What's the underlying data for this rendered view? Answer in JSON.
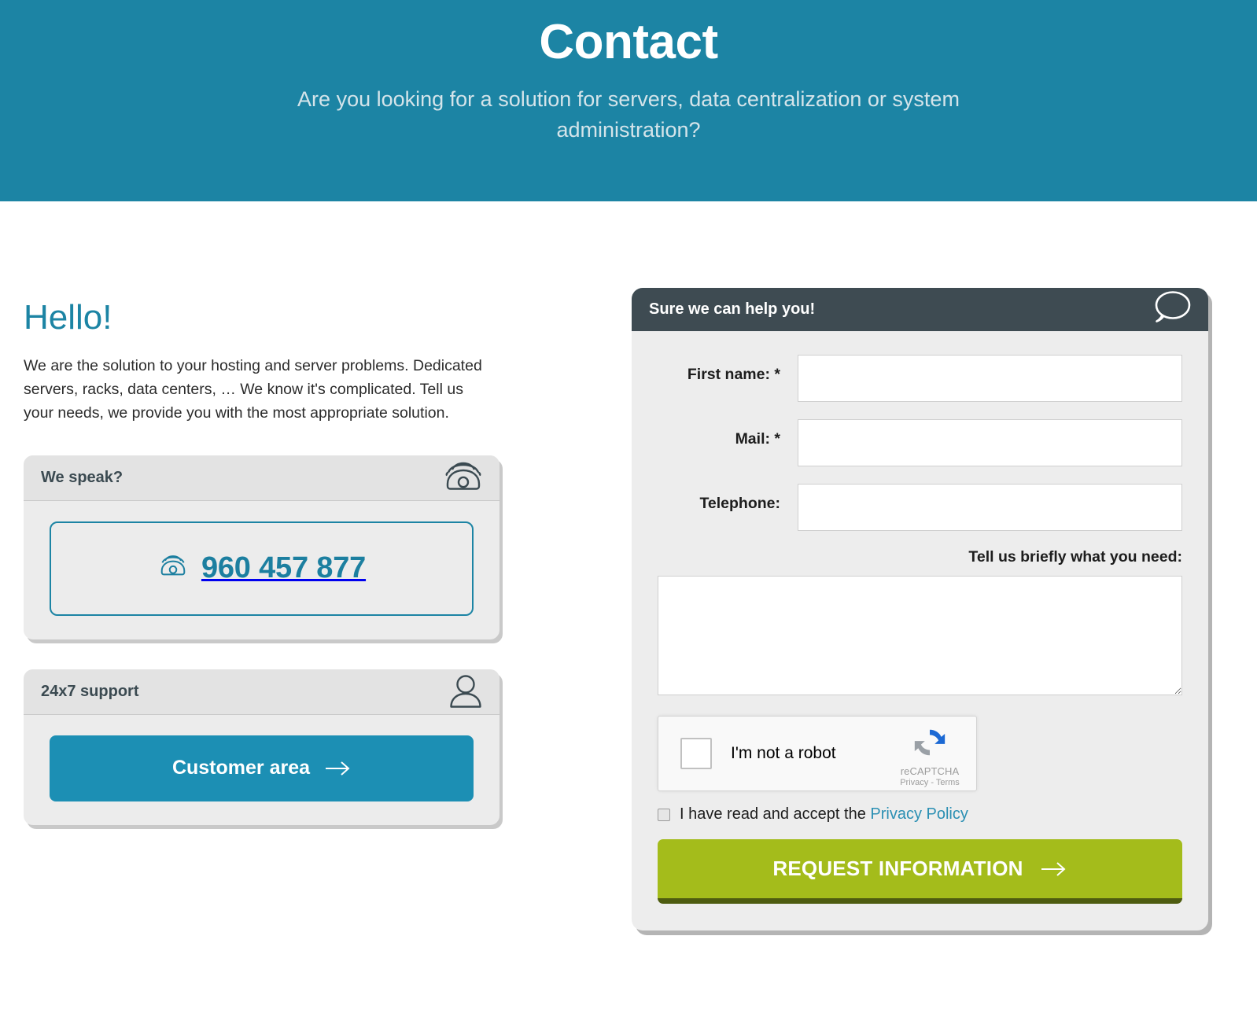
{
  "hero": {
    "title": "Contact",
    "subtitle": "Are you looking for a solution for servers, data centralization or system administration?",
    "bg_color": "#1c84a4"
  },
  "intro": {
    "heading": "Hello!",
    "body": "We are the solution to your hosting and server problems. Dedicated servers, racks, data centers, … We know it's complicated. Tell us your needs, we provide you with the most appropriate solution.",
    "heading_color": "#1c84a4"
  },
  "phone_card": {
    "header_title": "We speak?",
    "header_icon": "telephone-icon",
    "phone_number": "960 457 877",
    "phone_icon": "telephone-icon",
    "accent_color": "#1c7fa0"
  },
  "support_card": {
    "header_title": "24x7 support",
    "header_icon": "user-icon",
    "button_label": "Customer area",
    "button_icon": "arrow-right-icon",
    "button_color": "#1c8fb4"
  },
  "form": {
    "header_title": "Sure we can help you!",
    "header_icon": "speech-bubble-icon",
    "header_bg": "#3e4b52",
    "fields": [
      {
        "label": "First name: *",
        "value": "",
        "placeholder": ""
      },
      {
        "label": "Mail: *",
        "value": "",
        "placeholder": ""
      },
      {
        "label": "Telephone:",
        "value": "",
        "placeholder": ""
      }
    ],
    "message_label": "Tell us briefly what you need:",
    "message_value": "",
    "recaptcha": {
      "label": "I'm not a robot",
      "brand": "reCAPTCHA",
      "legal": "Privacy - Terms",
      "icon": "recaptcha-icon",
      "checked": false
    },
    "privacy": {
      "text_before": "I have read and accept the",
      "link_label": "Privacy Policy",
      "link_color": "#2a8fb3",
      "checked": false
    },
    "submit": {
      "label": "REQUEST INFORMATION",
      "icon": "arrow-right-icon",
      "color": "#a4bc1b"
    }
  }
}
